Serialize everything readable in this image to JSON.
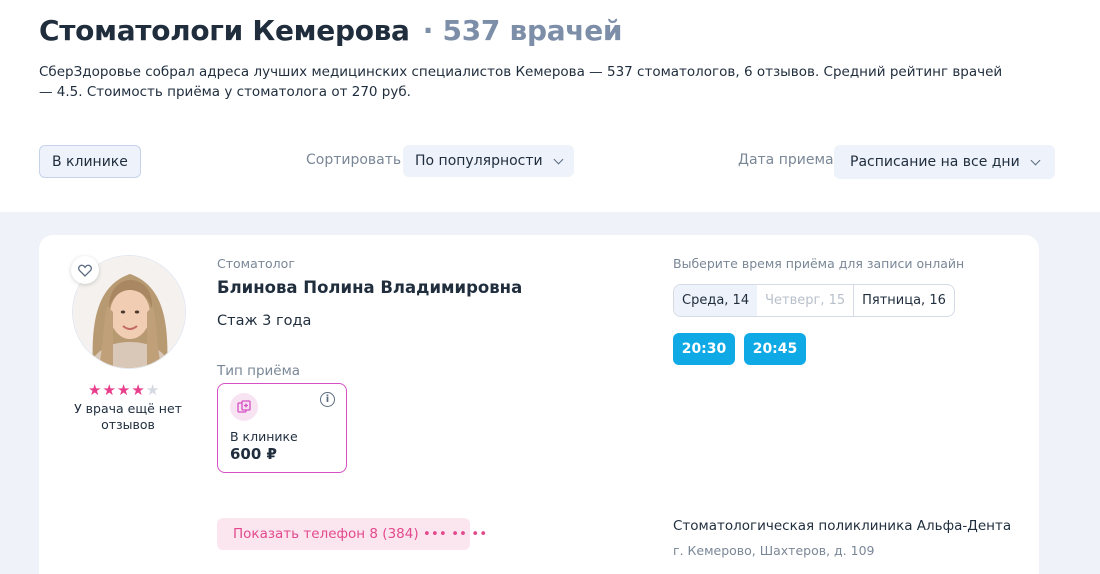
{
  "header": {
    "title": "Стоматологи Кемерова",
    "count": "· 537 врачей",
    "description": "СберЗдоровье собрал адреса лучших медицинских специалистов Кемерова — 537 стоматологов, 6 отзывов. Средний рейтинг врачей — 4.5. Стоимость приёма у стоматолога от 270 руб."
  },
  "filters": {
    "location_chip": "В клинике",
    "sort_label": "Сортировать",
    "sort_value": "По популярности",
    "date_label": "Дата приема",
    "date_value": "Расписание на все дни"
  },
  "doctor": {
    "specialty": "Стоматолог",
    "name": "Блинова Полина Владимировна",
    "experience": "Стаж 3 года",
    "rating": 4,
    "rating_max": 5,
    "reviews_text": "У врача ещё нет отзывов",
    "visit_type_label": "Тип приёма",
    "visit": {
      "name": "В клинике",
      "price": "600 ₽",
      "icon": "clinic-icon"
    },
    "phone_button": "Показать телефон 8 (384) ••• •• ••"
  },
  "schedule": {
    "label": "Выберите время приёма для записи онлайн",
    "days": [
      {
        "label": "Среда, 14",
        "state": "active"
      },
      {
        "label": "Четверг, 15",
        "state": "disabled"
      },
      {
        "label": "Пятница, 16",
        "state": "normal"
      }
    ],
    "slots": [
      "20:30",
      "20:45"
    ]
  },
  "clinic": {
    "name": "Стоматологическая поликлиника Альфа-Дента",
    "address": "г. Кемерово, Шахтеров, д. 109"
  },
  "colors": {
    "accent_blue": "#0fa9e6",
    "accent_pink": "#e24a8d",
    "star_filled": "#e83e8c",
    "star_empty": "#d4d9e2"
  }
}
